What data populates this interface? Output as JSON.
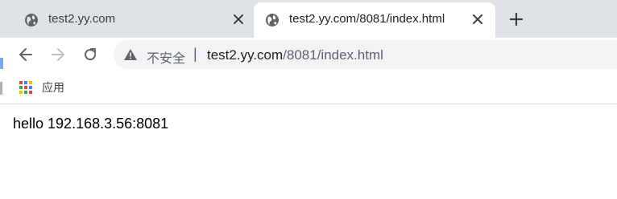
{
  "tabs": [
    {
      "title": "test2.yy.com",
      "favicon": "globe-icon",
      "active": false
    },
    {
      "title": "test2.yy.com/8081/index.html",
      "favicon": "globe-icon",
      "active": true
    }
  ],
  "toolbar": {
    "back_icon": "arrow-left-icon",
    "forward_icon": "arrow-right-icon",
    "reload_icon": "reload-icon"
  },
  "omnibox": {
    "security_icon": "warning-triangle-icon",
    "security_label": "不安全",
    "separator": "|",
    "url_host": "test2.yy.com",
    "url_rest": "/8081/index.html"
  },
  "bookmarks": {
    "apps_label": "应用",
    "apps_colors": [
      "#ea4335",
      "#4285f4",
      "#fbbc05",
      "#34a853",
      "#ea4335",
      "#4285f4",
      "#fbbc05",
      "#34a853",
      "#ea4335"
    ]
  },
  "page": {
    "body_text": "hello 192.168.3.56:8081"
  },
  "colors": {
    "tab_strip": "#dee1e6",
    "omnibox": "#f1f3f4",
    "icon": "#5f6368"
  }
}
